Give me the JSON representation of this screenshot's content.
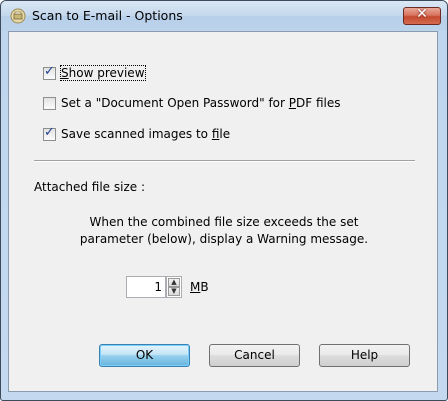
{
  "window": {
    "title": "Scan to E-mail - Options",
    "close_symbol": "✕"
  },
  "options": {
    "show_preview": {
      "label_u": "S",
      "label_rest": "how preview",
      "checked": true
    },
    "pdf_password": {
      "label_pre": "Set a \"Document Open Password\" for ",
      "label_u": "P",
      "label_rest": "DF files",
      "checked": false
    },
    "save_images": {
      "label_pre": "Save scanned images to ",
      "label_u": "f",
      "label_rest": "ile",
      "checked": true
    }
  },
  "size": {
    "heading": "Attached file size :",
    "description_line1": "When the combined file size exceeds the set",
    "description_line2": "parameter (below), display a Warning message.",
    "value": "1",
    "unit_u": "M",
    "unit_rest": "B"
  },
  "buttons": {
    "ok": "OK",
    "cancel": "Cancel",
    "help": "Help"
  }
}
